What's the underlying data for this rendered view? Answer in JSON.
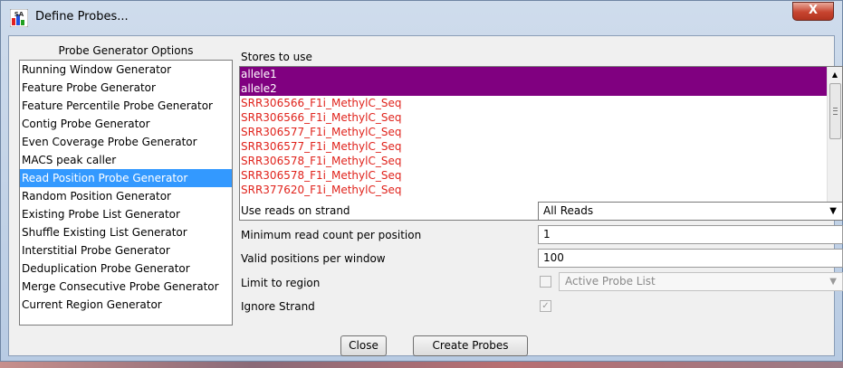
{
  "window": {
    "title": "Define Probes...",
    "close_glyph": "X",
    "app_icon_label": "SA"
  },
  "left_panel": {
    "title": "Probe Generator Options",
    "items": [
      {
        "label": "Running Window Generator",
        "selected": false
      },
      {
        "label": "Feature Probe Generator",
        "selected": false
      },
      {
        "label": "Feature Percentile Probe Generator",
        "selected": false
      },
      {
        "label": "Contig Probe Generator",
        "selected": false
      },
      {
        "label": "Even Coverage Probe Generator",
        "selected": false
      },
      {
        "label": "MACS peak caller",
        "selected": false
      },
      {
        "label": "Read Position Probe Generator",
        "selected": true
      },
      {
        "label": "Random Position Generator",
        "selected": false
      },
      {
        "label": "Existing Probe List Generator",
        "selected": false
      },
      {
        "label": "Shuffle Existing List Generator",
        "selected": false
      },
      {
        "label": "Interstitial Probe Generator",
        "selected": false
      },
      {
        "label": "Deduplication Probe Generator",
        "selected": false
      },
      {
        "label": "Merge Consecutive Probe Generator",
        "selected": false
      },
      {
        "label": "Current Region Generator",
        "selected": false
      }
    ]
  },
  "stores": {
    "label": "Stores to use",
    "items": [
      {
        "label": "allele1",
        "selected": true
      },
      {
        "label": "allele2",
        "selected": true
      },
      {
        "label": "SRR306566_F1i_MethylC_Seq",
        "selected": false
      },
      {
        "label": "SRR306566_F1i_MethylC_Seq",
        "selected": false
      },
      {
        "label": "SRR306577_F1i_MethylC_Seq",
        "selected": false
      },
      {
        "label": "SRR306577_F1i_MethylC_Seq",
        "selected": false
      },
      {
        "label": "SRR306578_F1i_MethylC_Seq",
        "selected": false
      },
      {
        "label": "SRR306578_F1i_MethylC_Seq",
        "selected": false
      },
      {
        "label": "SRR377620_F1i_MethylC_Seq",
        "selected": false
      }
    ]
  },
  "options": {
    "strand_label": "Use reads on strand",
    "strand_value": "All Reads",
    "min_count_label": "Minimum read count per position",
    "min_count_value": "1",
    "valid_positions_label": "Valid positions per window",
    "valid_positions_value": "100",
    "limit_region_label": "Limit to region",
    "limit_region_checked": false,
    "limit_region_value": "Active Probe List",
    "ignore_strand_label": "Ignore Strand",
    "ignore_strand_checked": true
  },
  "buttons": {
    "close_label": "Close",
    "create_label": "Create Probes"
  }
}
